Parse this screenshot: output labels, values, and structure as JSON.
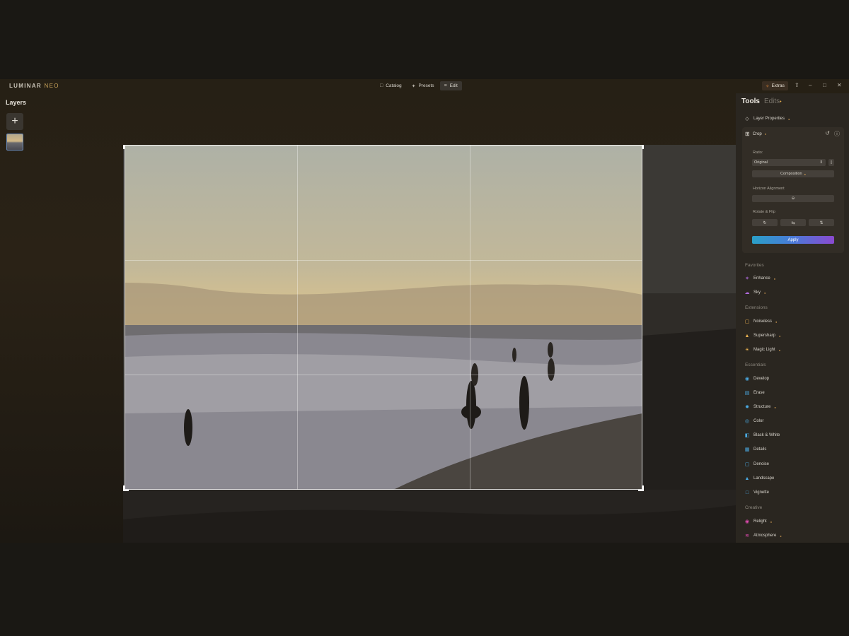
{
  "app": {
    "logo_main": "LUMINAR",
    "logo_sub": "NEO"
  },
  "nav": {
    "catalog": "Catalog",
    "presets": "Presets",
    "edit": "Edit"
  },
  "extras": "Extras",
  "layers": {
    "title": "Layers",
    "add": "+"
  },
  "panel": {
    "tab_tools": "Tools",
    "tab_edits": "Edits",
    "layer_properties": "Layer Properties",
    "crop": {
      "title": "Crop",
      "ratio_label": "Ratio:",
      "ratio_value": "Original",
      "composition": "Composition",
      "horizon_label": "Horizon Alignment",
      "rotate_label": "Rotate & Flip",
      "apply": "Apply"
    },
    "favorites_label": "Favorites",
    "favorites": [
      "Enhance",
      "Sky"
    ],
    "extensions_label": "Extensions",
    "extensions": [
      "Noiseless",
      "Supersharp",
      "Magic Light"
    ],
    "essentials_label": "Essentials",
    "essentials": [
      "Develop",
      "Erase",
      "Structure",
      "Color",
      "Black & White",
      "Details",
      "Denoise",
      "Landscape",
      "Vignette"
    ],
    "creative_label": "Creative",
    "creative": [
      "Relight",
      "Atmosphere"
    ]
  },
  "colors": {
    "accent_from": "#2aa0c8",
    "accent_to": "#8a4ad0",
    "pro_badge": "#c89650"
  }
}
